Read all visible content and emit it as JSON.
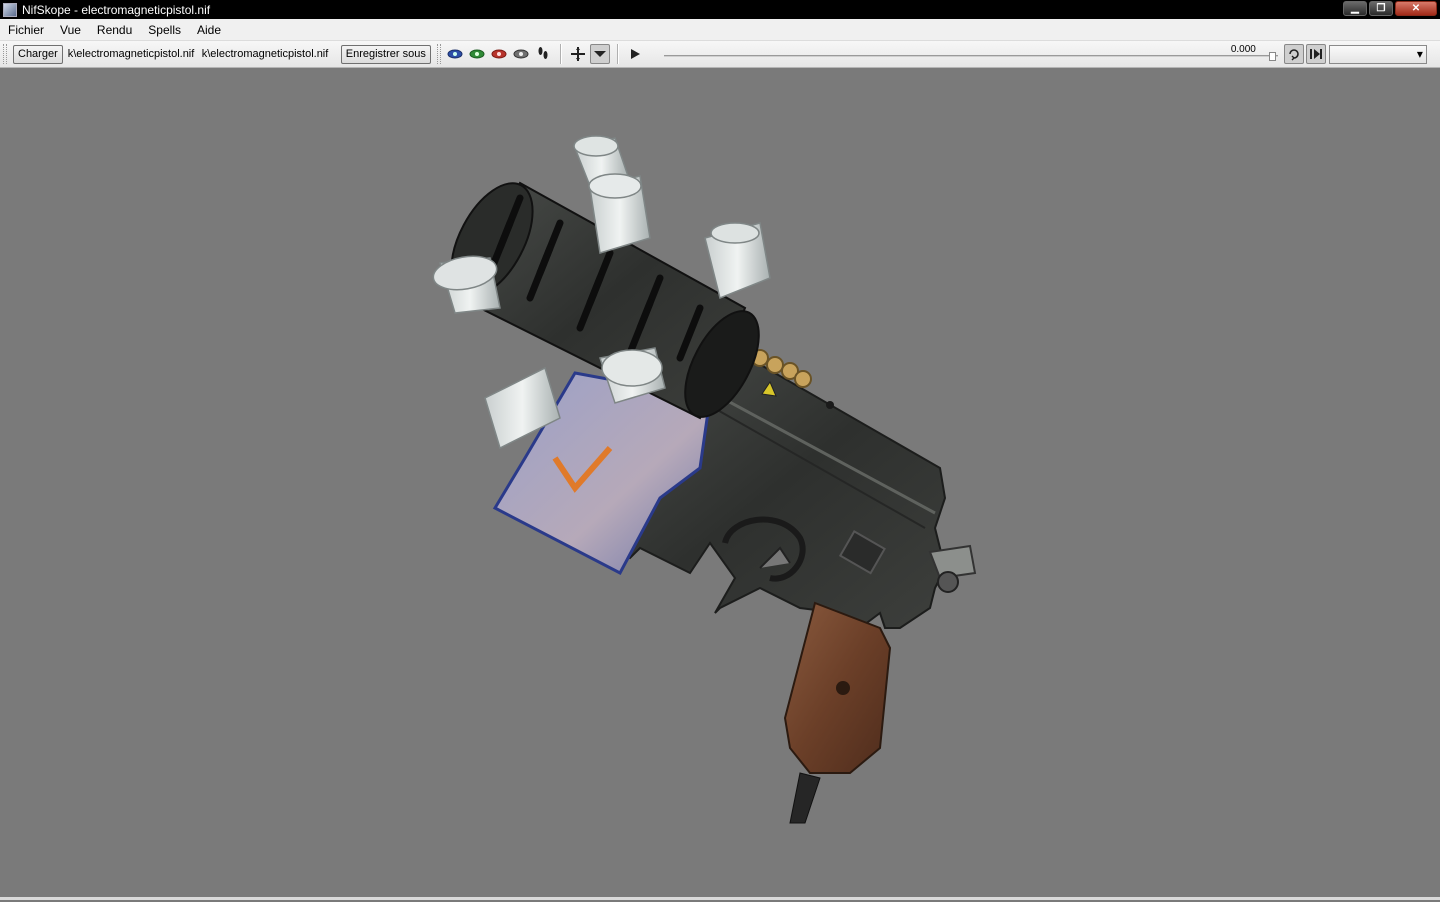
{
  "window": {
    "title": "NifSkope - electromagneticpistol.nif",
    "minimize": "▁",
    "restore": "❐",
    "close": "✕"
  },
  "menu": [
    "Fichier",
    "Vue",
    "Rendu",
    "Spells",
    "Aide"
  ],
  "toolbar": {
    "load_label": "Charger",
    "load_path": "k\\electromagneticpistol.nif",
    "save_path": "k\\electromagneticpistol.nif",
    "save_as_label": "Enregistrer sous",
    "time_value": "0.000",
    "view_icons": [
      "eye-blue-icon",
      "eye-green-icon",
      "eye-red-icon",
      "eye-gray-icon",
      "footprints-icon",
      "move-axis-icon",
      "dropdown-arrow-icon"
    ],
    "play_icon": "play-icon",
    "loop_icon": "loop-icon",
    "step_icon": "step-icon"
  },
  "viewport": {
    "background": "#7a7a7a",
    "model": "electromagnetic-pistol"
  }
}
